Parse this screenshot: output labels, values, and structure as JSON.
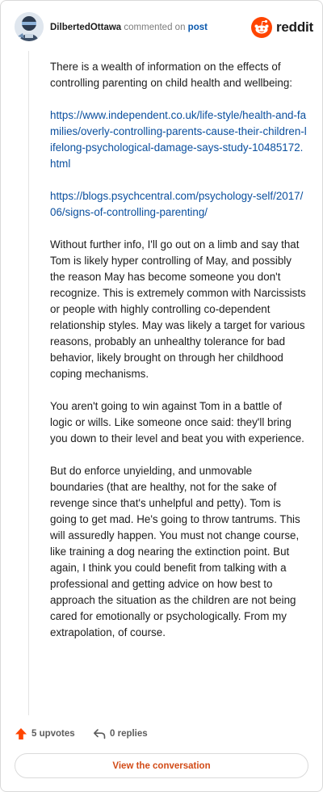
{
  "comment": {
    "username": "DilbertedOttawa",
    "verb": "commented on",
    "target": "post",
    "brand": "reddit",
    "paragraphs": [
      "There is a wealth of information on the effects of controlling parenting on child health and wellbeing:",
      "Without further info, I'll go out on a limb and say that Tom is likely hyper controlling of May, and possibly the reason May has become someone you don't recognize. This is extremely common with Narcissists or people with highly controlling co-dependent relationship styles. May was likely a target for various reasons, probably an unhealthy tolerance for bad behavior, likely brought on through her childhood coping mechanisms.",
      "You aren't going to win against Tom in a battle of logic or wills. Like someone once said: they'll bring you down to their level and beat you with experience.",
      "But do enforce unyielding, and unmovable boundaries (that are healthy, not for the sake of revenge since that's unhelpful and petty). Tom is going to get mad. He's going to throw tantrums. This will assuredly happen. You must not change course, like training a dog nearing the extinction point. But again, I think you could benefit from talking with a professional and getting advice on how best to approach the situation as the children are not being cared for emotionally or psychologically. From my extrapolation, of course."
    ],
    "links": [
      "https://www.independent.co.uk/life-style/health-and-families/overly-controlling-parents-cause-their-children-lifelong-psychological-damage-says-study-10485172.html",
      "https://blogs.psychcentral.com/psychology-self/2017/06/signs-of-controlling-parenting/"
    ]
  },
  "footer": {
    "upvotes_label": "5 upvotes",
    "replies_label": "0 replies",
    "view_button": "View the conversation"
  },
  "icons": {
    "upvote": "upvote-arrow-icon",
    "reply": "reply-arrow-icon",
    "brand": "reddit-snoo-icon",
    "avatar": "user-avatar"
  },
  "colors": {
    "link": "#0a4f9e",
    "upvote": "#ff4500",
    "view_button_text": "#d24b17",
    "brand_orange": "#ff4500"
  }
}
